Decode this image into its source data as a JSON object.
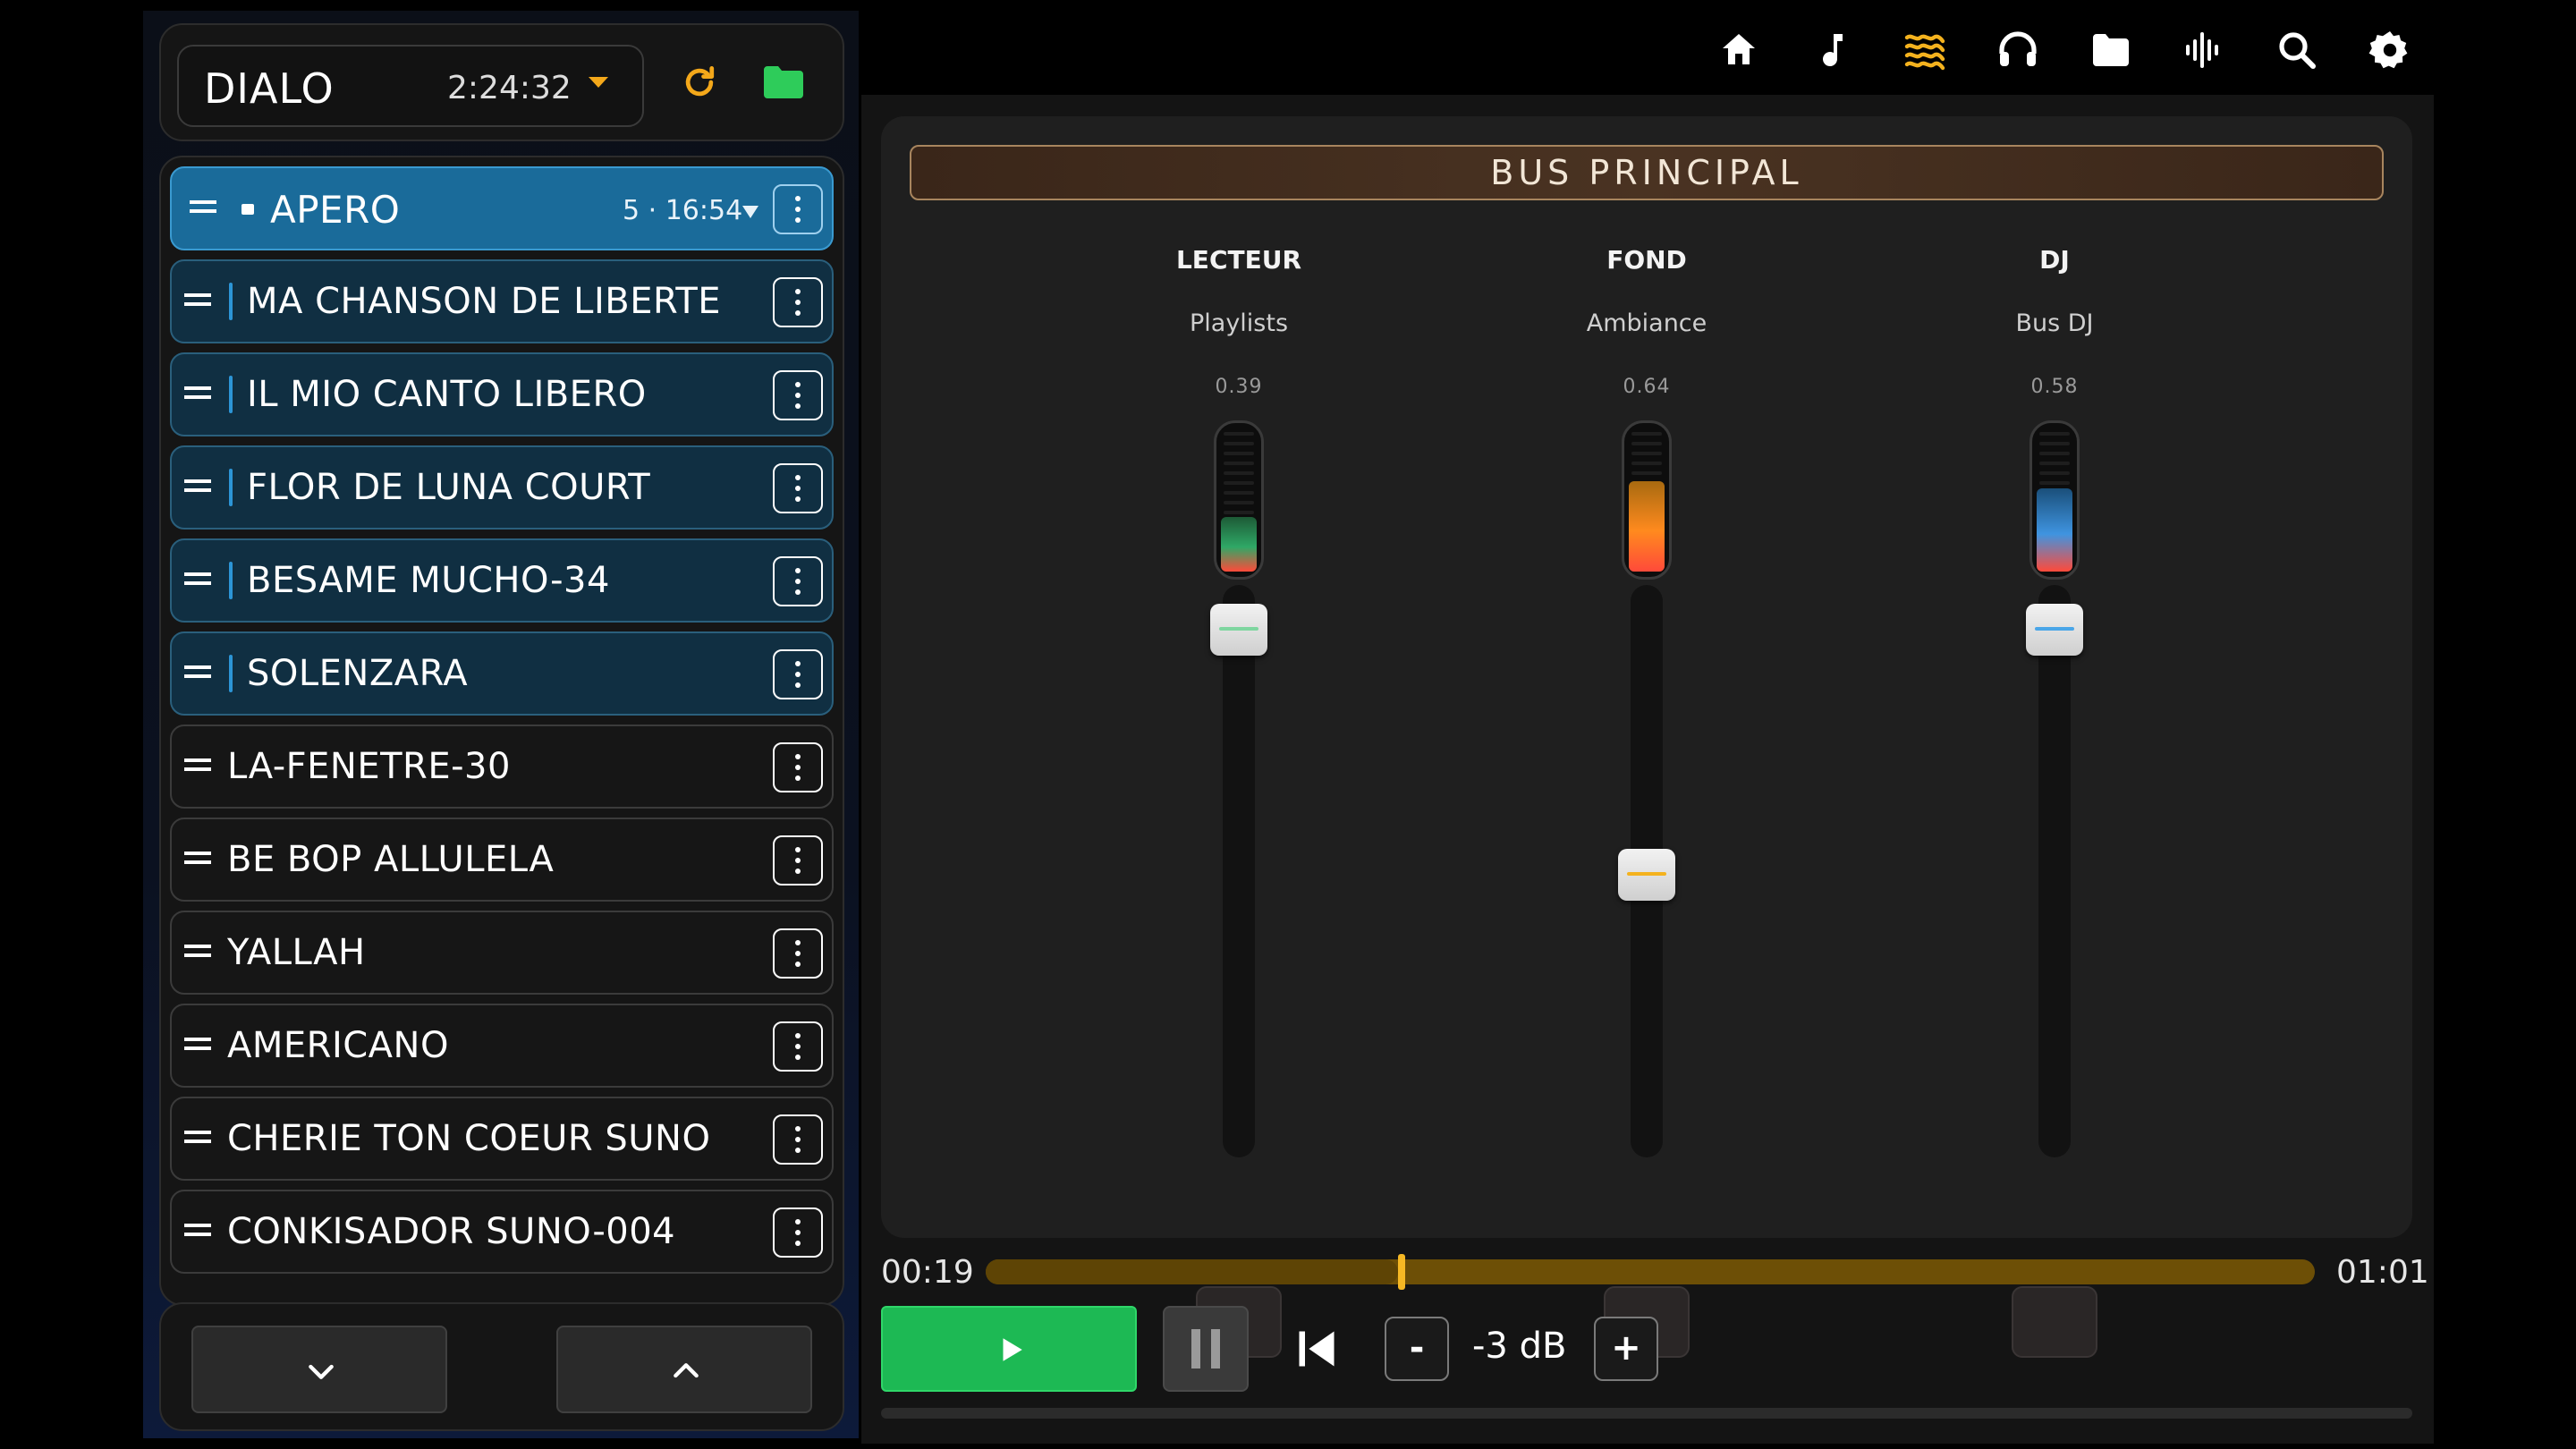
{
  "session": {
    "name": "DIALO",
    "duration": "2:24:32"
  },
  "playlist": {
    "group": {
      "title": "APERO",
      "meta": "5 · 16:54"
    },
    "items": [
      {
        "title": "MA CHANSON DE LIBERTE",
        "in_group": true
      },
      {
        "title": "IL MIO CANTO LIBERO",
        "in_group": true
      },
      {
        "title": "FLOR DE LUNA COURT",
        "in_group": true
      },
      {
        "title": "BESAME MUCHO-34",
        "in_group": true
      },
      {
        "title": "SOLENZARA",
        "in_group": true
      },
      {
        "title": "LA-FENETRE-30",
        "in_group": false
      },
      {
        "title": "BE BOP ALLULELA",
        "in_group": false
      },
      {
        "title": "YALLAH",
        "in_group": false
      },
      {
        "title": "AMERICANO",
        "in_group": false
      },
      {
        "title": "CHERIE TON COEUR SUNO",
        "in_group": false
      },
      {
        "title": "CONKISADOR SUNO-004",
        "in_group": false
      }
    ]
  },
  "topnav": {
    "icons": [
      "home-icon",
      "music-note-icon",
      "waves-icon",
      "headphones-icon",
      "folder-icon",
      "waveform-icon",
      "search-icon",
      "gear-icon"
    ],
    "active": "waves-icon",
    "active_color": "#f4b21e"
  },
  "mixer": {
    "bus_title": "BUS PRINCIPAL",
    "channels": [
      {
        "name": "LECTEUR",
        "subtitle": "Playlists",
        "value": "0.39",
        "fader": 0.95,
        "meter_level": 0.38,
        "color": "#7fd6a0",
        "meter_colors": [
          "#ff4a3a",
          "#2fa866",
          "#1d5a36"
        ]
      },
      {
        "name": "FOND",
        "subtitle": "Ambiance",
        "value": "0.64",
        "fader": 0.48,
        "meter_level": 0.63,
        "color": "#f4b21e",
        "meter_colors": [
          "#ff4a3a",
          "#ff8a1e",
          "#a86a10"
        ]
      },
      {
        "name": "DJ",
        "subtitle": "Bus DJ",
        "value": "0.58",
        "fader": 0.95,
        "meter_level": 0.58,
        "color": "#4aa6e8",
        "meter_colors": [
          "#ff4a3a",
          "#3f94e0",
          "#1a4f7a"
        ]
      }
    ]
  },
  "transport": {
    "position": "00:19",
    "duration": "01:01",
    "progress": 0.31,
    "gain": "-3 dB",
    "minus_label": "-",
    "plus_label": "+",
    "play_color": "#1db954"
  }
}
